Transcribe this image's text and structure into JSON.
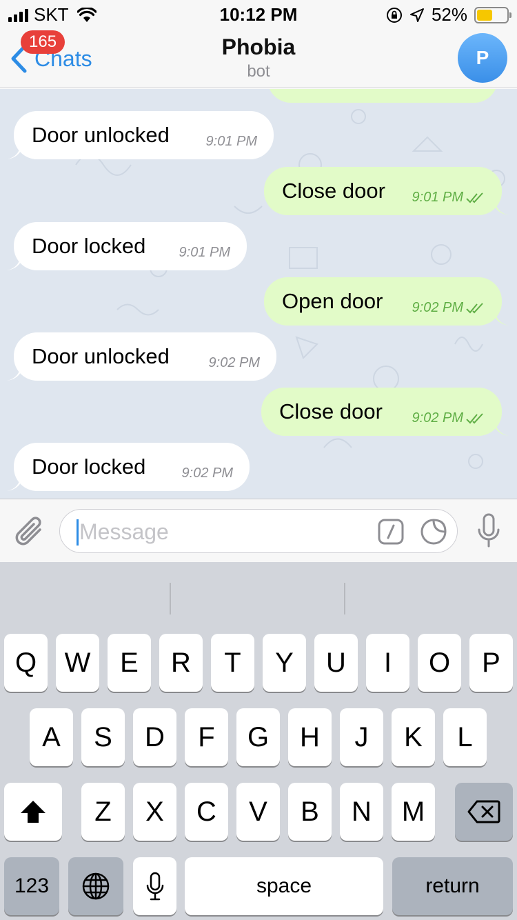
{
  "status_bar": {
    "carrier": "SKT",
    "time": "10:12 PM",
    "battery": "52%",
    "battery_level": 0.52,
    "battery_color": "#f6c700"
  },
  "nav": {
    "back_label": "Chats",
    "unread_badge": "165",
    "title": "Phobia",
    "subtitle": "bot",
    "avatar_letter": "P",
    "accent_color": "#2d8ce5"
  },
  "messages": [
    {
      "dir": "in",
      "text": "Door unlocked",
      "time": "9:01 PM"
    },
    {
      "dir": "out",
      "text": "Close door",
      "time": "9:01 PM",
      "status": "read"
    },
    {
      "dir": "in",
      "text": "Door locked",
      "time": "9:01 PM"
    },
    {
      "dir": "out",
      "text": "Open door",
      "time": "9:02 PM",
      "status": "read"
    },
    {
      "dir": "in",
      "text": "Door unlocked",
      "time": "9:02 PM"
    },
    {
      "dir": "out",
      "text": "Close door",
      "time": "9:02 PM",
      "status": "read"
    },
    {
      "dir": "in",
      "text": "Door locked",
      "time": "9:02 PM"
    }
  ],
  "input": {
    "placeholder": "Message",
    "icons": [
      "paperclip-icon",
      "bot-command-icon",
      "sticker-icon",
      "microphone-icon"
    ]
  },
  "keyboard": {
    "row1": [
      "Q",
      "W",
      "E",
      "R",
      "T",
      "Y",
      "U",
      "I",
      "O",
      "P"
    ],
    "row2": [
      "A",
      "S",
      "D",
      "F",
      "G",
      "H",
      "J",
      "K",
      "L"
    ],
    "row3": [
      "Z",
      "X",
      "C",
      "V",
      "B",
      "N",
      "M"
    ],
    "numbers_label": "123",
    "space_label": "space",
    "return_label": "return"
  }
}
